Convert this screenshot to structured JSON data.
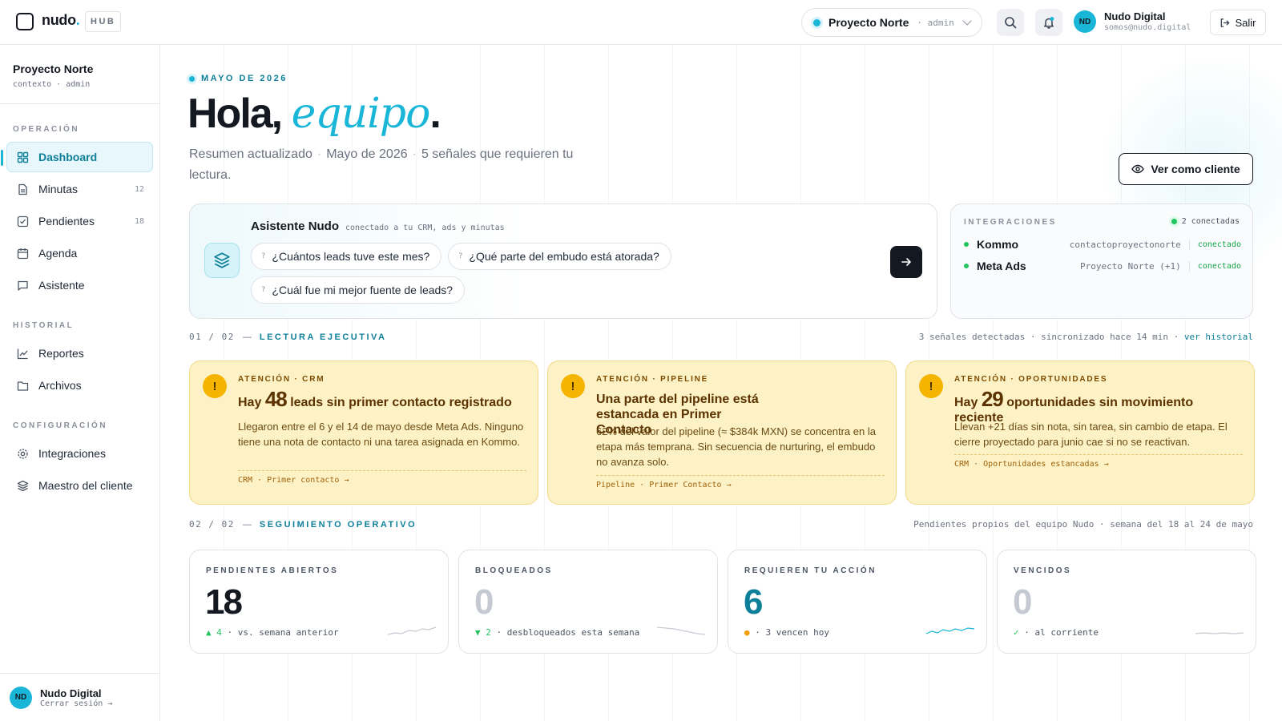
{
  "topbar": {
    "logo_text": "nudo",
    "logo_dot": ".",
    "hub_tag": "HUB",
    "project_name": "Proyecto Norte",
    "project_role": "· admin",
    "user_initials": "ND",
    "user_name": "Nudo Digital",
    "user_email": "somos@nudo.digital",
    "logout_label": "Salir"
  },
  "sidebar": {
    "title": "Proyecto Norte",
    "subtitle": "contexto · admin",
    "sections": [
      {
        "label": "OPERACIÓN"
      },
      {
        "label": "HISTORIAL"
      },
      {
        "label": "CONFIGURACIÓN"
      }
    ],
    "items": [
      {
        "label": "Dashboard",
        "count": ""
      },
      {
        "label": "Minutas",
        "count": "12"
      },
      {
        "label": "Pendientes",
        "count": "18"
      },
      {
        "label": "Agenda",
        "count": ""
      },
      {
        "label": "Asistente",
        "count": ""
      },
      {
        "label": "Reportes",
        "count": ""
      },
      {
        "label": "Archivos",
        "count": ""
      },
      {
        "label": "Integraciones",
        "count": ""
      },
      {
        "label": "Maestro del cliente",
        "count": ""
      }
    ],
    "footer_initials": "ND",
    "footer_name": "Nudo Digital",
    "footer_logout": "Cerrar sesión →"
  },
  "hero": {
    "eyebrow": "MAYO DE 2026",
    "greeting": "Hola,",
    "greeting_highlight": "equipo",
    "greeting_end": ".",
    "summary_1": "Resumen actualizado",
    "summary_2": "Mayo de 2026",
    "summary_3": "5 señales que requieren tu lectura.",
    "client_button": "Ver como cliente"
  },
  "assistant": {
    "title": "Asistente Nudo",
    "subtitle": "conectado a tu CRM, ads y minutas",
    "questions": [
      "¿Cuántos leads tuve este mes?",
      "¿Qué parte del embudo está atorada?",
      "¿Cuál fue mi mejor fuente de leads?"
    ],
    "q_mark": "?"
  },
  "integrations": {
    "label": "INTEGRACIONES",
    "count": "2 conectadas",
    "rows": [
      {
        "name": "Kommo",
        "account": "contactoproyectonorte",
        "status": "conectado"
      },
      {
        "name": "Meta Ads",
        "account": "Proyecto Norte (+1)",
        "status": "conectado"
      }
    ]
  },
  "section1": {
    "index": "01 / 02",
    "dash": "—",
    "label": "LECTURA EJECUTIVA",
    "right_text": "3 señales detectadas · sincronizado hace 14 min ·",
    "right_link": "ver historial"
  },
  "alerts": [
    {
      "tag": "ATENCIÓN · CRM",
      "title_pre": "Hay",
      "title_num": "48",
      "title_post": "leads sin primer contacto registrado",
      "body": "Llegaron entre el 6 y el 14 de mayo desde Meta Ads. Ninguno tiene una nota de contacto ni una tarea asignada en Kommo.",
      "link": "CRM · Primer contacto →"
    },
    {
      "tag": "ATENCIÓN · PIPELINE",
      "title": "Una parte del pipeline está estancada en Primer Contacto",
      "body": "62% del valor del pipeline (≈ $384k MXN) se concentra en la etapa más temprana. Sin secuencia de nurturing, el embudo no avanza solo.",
      "link": "Pipeline · Primer Contacto →"
    },
    {
      "tag": "ATENCIÓN · OPORTUNIDADES",
      "title_pre": "Hay",
      "title_num": "29",
      "title_post": "oportunidades sin movimiento reciente",
      "body": "Llevan +21 días sin nota, sin tarea, sin cambio de etapa. El cierre proyectado para junio cae si no se reactivan.",
      "link": "CRM · Oportunidades estancadas →"
    }
  ],
  "alert_icon": "!",
  "section2": {
    "index": "02 / 02",
    "dash": "—",
    "label": "SEGUIMIENTO OPERATIVO",
    "right_text": "Pendientes propios del equipo Nudo · semana del 18 al 24 de mayo"
  },
  "kpis": [
    {
      "label": "PENDIENTES ABIERTOS",
      "value": "18",
      "marker": "▲",
      "delta": "4",
      "foot": "· vs. semana anterior",
      "color": "#141821",
      "marker_color": "#22c55e"
    },
    {
      "label": "BLOQUEADOS",
      "value": "0",
      "marker": "▼",
      "delta": "2",
      "foot": "· desbloqueados esta semana",
      "color": "#c5cad2",
      "marker_color": "#22c55e"
    },
    {
      "label": "REQUIEREN TU ACCIÓN",
      "value": "6",
      "marker": "●",
      "delta": "",
      "foot": "· 3 vencen hoy",
      "color": "#0e7f99",
      "marker_color": "#f59e0b"
    },
    {
      "label": "VENCIDOS",
      "value": "0",
      "marker": "✓",
      "delta": "",
      "foot": "· al corriente",
      "color": "#c5cad2",
      "marker_color": "#22c55e"
    }
  ],
  "colors": {
    "accent": "#19b6d8",
    "accent_dark": "#0e7f99",
    "alert_bg": "#fdf2c6",
    "alert_icon": "#f4b400"
  }
}
